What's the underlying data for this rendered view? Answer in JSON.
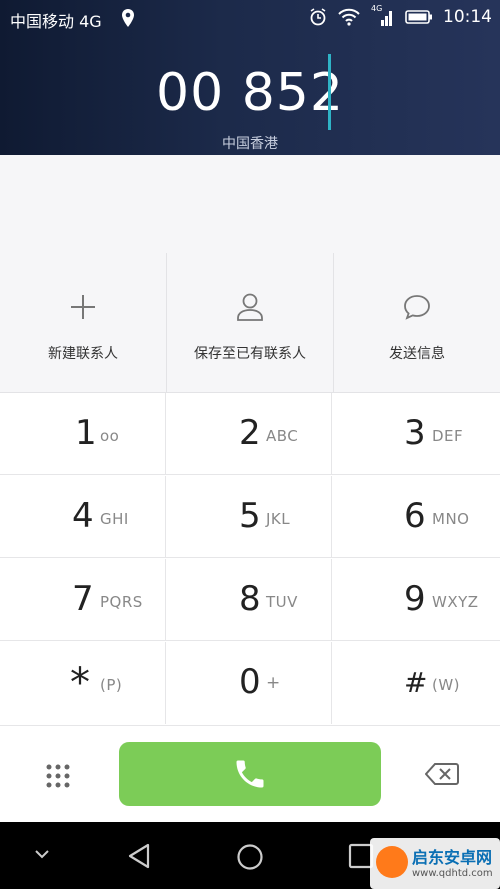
{
  "status": {
    "carrier": "中国移动 4G",
    "network_small": "4G",
    "time": "10:14"
  },
  "dial": {
    "number": "00 852",
    "region": "中国香港"
  },
  "actions": [
    {
      "label": "新建联系人",
      "icon": "plus-icon"
    },
    {
      "label": "保存至已有联系人",
      "icon": "person-icon"
    },
    {
      "label": "发送信息",
      "icon": "message-icon"
    }
  ],
  "keys": [
    {
      "digit": "1",
      "sub": "ᴏᴏ"
    },
    {
      "digit": "2",
      "sub": "ABC"
    },
    {
      "digit": "3",
      "sub": "DEF"
    },
    {
      "digit": "4",
      "sub": "GHI"
    },
    {
      "digit": "5",
      "sub": "JKL"
    },
    {
      "digit": "6",
      "sub": "MNO"
    },
    {
      "digit": "7",
      "sub": "PQRS"
    },
    {
      "digit": "8",
      "sub": "TUV"
    },
    {
      "digit": "9",
      "sub": "WXYZ"
    },
    {
      "digit": "*",
      "sub": "(P)"
    },
    {
      "digit": "0",
      "sub": "+"
    },
    {
      "digit": "#",
      "sub": "(W)"
    }
  ],
  "watermark": {
    "title": "启东安卓网",
    "url": "www.qdhtd.com"
  },
  "colors": {
    "call_green": "#7ccc57",
    "cursor": "#2fb3c6",
    "header_dark": "#1c2a4a"
  }
}
